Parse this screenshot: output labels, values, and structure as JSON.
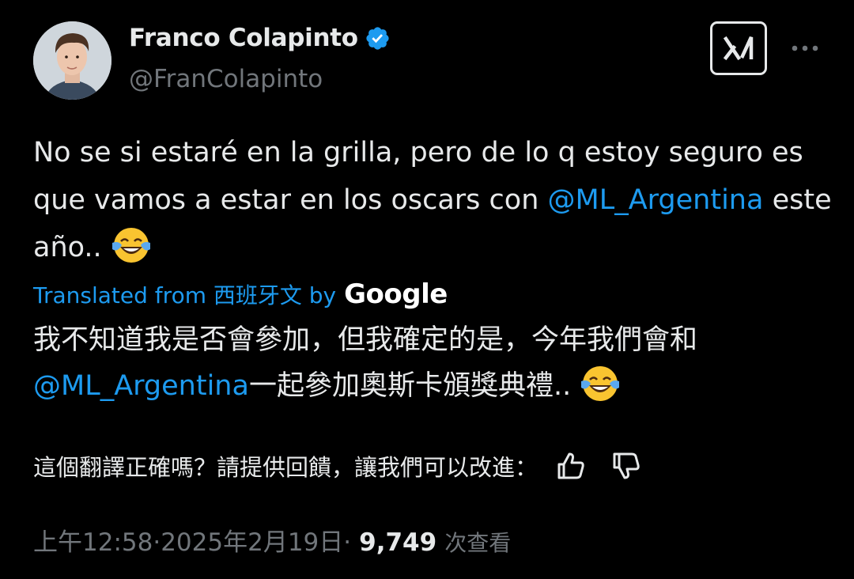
{
  "author": {
    "name": "Franco Colapinto",
    "handle": "@FranColapinto",
    "verified": true,
    "avatar_icon": "profile-photo"
  },
  "tweet": {
    "text_part1": "No se si estaré en la grilla, pero de lo q estoy seguro es que vamos a estar en los oscars con ",
    "mention": "@ML_Argentina",
    "text_part2": " este año.. ",
    "emoji": "face-with-tears-of-joy"
  },
  "translation": {
    "prefix": "Translated from 西班牙文 by",
    "provider": "Google",
    "text_part1": "我不知道我是否會參加，但我確定的是，今年我們會和",
    "mention": "@ML_Argentina",
    "text_part2": "一起參加奧斯卡頒獎典禮.. ",
    "feedback_prompt": "這個翻譯正確嗎？請提供回饋，讓我們可以改進："
  },
  "meta": {
    "time": "上午12:58",
    "separator": " · ",
    "date": "2025年2月19日",
    "views_count": "9,749",
    "views_label": "次查看"
  },
  "colors": {
    "background": "#000000",
    "text": "#e7e9ea",
    "secondary": "#71767b",
    "link": "#1d9bf0",
    "verified": "#1d9bf0"
  }
}
